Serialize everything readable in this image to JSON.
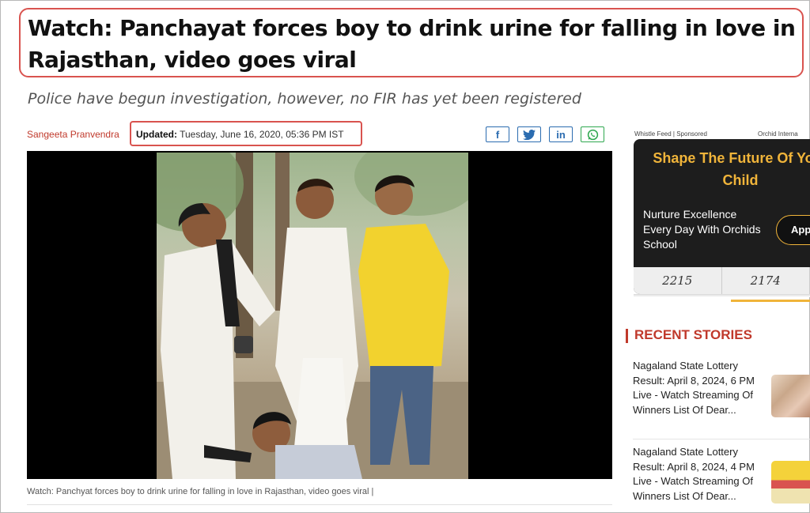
{
  "article": {
    "headline": "Watch: Panchayat forces boy to drink urine for falling in love in Rajasthan, video goes viral",
    "subheadline": "Police have begun investigation, however, no FIR has yet been registered",
    "author": "Sangeeta Pranvendra",
    "updated_label": "Updated:",
    "updated_value": "Tuesday, June 16, 2020, 05:36 PM IST",
    "caption": "Watch: Panchyat forces boy to drink urine for falling in love in Rajasthan, video goes viral |"
  },
  "share": [
    {
      "label": "f",
      "icon": "facebook-icon"
    },
    {
      "label": "t",
      "icon": "twitter-icon"
    },
    {
      "label": "in",
      "icon": "linkedin-icon"
    },
    {
      "label": "",
      "icon": "whatsapp-icon"
    }
  ],
  "ad": {
    "sponsor_label": "Whistle Feed | Sponsored",
    "advertiser": "Orchid Interna",
    "title": "Shape The Future Of Your Child",
    "body": "Nurture Excellence Every Day With Orchids School",
    "button": "Apply",
    "scribble_left": "2215",
    "scribble_right": "2174",
    "accent_color": "#f0b43a"
  },
  "sidebar": {
    "section_title": "RECENT STORIES",
    "stories": [
      {
        "title": "Nagaland State Lottery Result: April 8, 2024, 6 PM Live - Watch Streaming Of Winners List Of Dear..."
      },
      {
        "title": "Nagaland State Lottery Result: April 8, 2024, 4 PM Live - Watch Streaming Of Winners List Of Dear..."
      }
    ]
  },
  "colors": {
    "highlight_red": "#d9534f",
    "brand_red": "#c0392b"
  }
}
